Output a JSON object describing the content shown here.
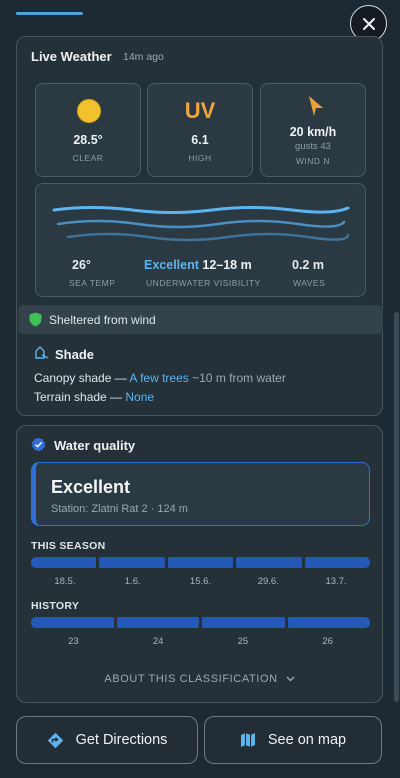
{
  "close_icon_name": "close-icon",
  "weather": {
    "title": "Live Weather",
    "updated": "14m ago",
    "tiles": {
      "temp": {
        "value": "28.5°",
        "label": "CLEAR",
        "icon": "sun-icon"
      },
      "uv": {
        "symbol": "UV",
        "value": "6.1",
        "label": "HIGH"
      },
      "wind": {
        "value": "20 km/h",
        "sub": "gusts 43",
        "label": "WIND N",
        "icon": "wind-arrow-icon"
      }
    },
    "sea": {
      "temp_value": "26°",
      "temp_label": "SEA TEMP",
      "visibility_rating": "Excellent",
      "visibility_range": "12–18 m",
      "visibility_label": "UNDERWATER VISIBILITY",
      "waves_value": "0.2 m",
      "waves_label": "WAVES"
    },
    "shelter_banner": "Sheltered from wind",
    "shade": {
      "title": "Shade",
      "canopy_label": "Canopy shade —",
      "canopy_value": "A few trees",
      "canopy_distance": "~10 m from water",
      "terrain_label": "Terrain shade —",
      "terrain_value": "None"
    }
  },
  "water_quality": {
    "title": "Water quality",
    "rating": "Excellent",
    "station": "Station: Zlatni Rat 2 · 124 m",
    "season_label": "THIS SEASON",
    "season_ticks": [
      "18.5.",
      "1.6.",
      "15.6.",
      "29.6.",
      "13.7."
    ],
    "history_label": "HISTORY",
    "history_ticks": [
      "23",
      "24",
      "25",
      "26"
    ],
    "about_link": "ABOUT THIS CLASSIFICATION"
  },
  "actions": {
    "directions": "Get Directions",
    "map": "See on map"
  },
  "colors": {
    "accent_blue": "#5db4ef",
    "bar_blue": "#2459b8",
    "sun_yellow": "#f2c12e",
    "uv_orange": "#f0a53a",
    "shelter_green": "#3fbf58"
  }
}
